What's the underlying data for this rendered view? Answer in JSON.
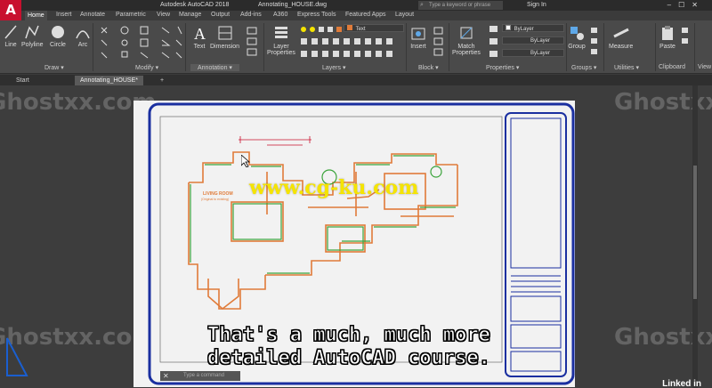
{
  "titlebar": {
    "app_title": "Autodesk AutoCAD 2018",
    "file_name": "Annotating_HOUSE.dwg",
    "search_placeholder": "Type a keyword or phrase",
    "signin": "Sign In",
    "window_buttons": "–☐✕"
  },
  "logo": {
    "letter": "A"
  },
  "ribbon_tabs": [
    {
      "label": "Home",
      "active": true
    },
    {
      "label": "Insert"
    },
    {
      "label": "Annotate"
    },
    {
      "label": "Parametric"
    },
    {
      "label": "View"
    },
    {
      "label": "Manage"
    },
    {
      "label": "Output"
    },
    {
      "label": "Add-ins"
    },
    {
      "label": "A360"
    },
    {
      "label": "Express Tools"
    },
    {
      "label": "Featured Apps"
    },
    {
      "label": "Layout"
    }
  ],
  "ribbon": {
    "draw": {
      "line": "Line",
      "polyline": "Polyline",
      "circle": "Circle",
      "arc": "Arc",
      "panel": "Draw"
    },
    "modify": {
      "panel": "Modify"
    },
    "annotation": {
      "text": "Text",
      "dimension": "Dimension",
      "panel": "Annotation"
    },
    "layers": {
      "layer_properties_l1": "Layer",
      "layer_properties_l2": "Properties",
      "layer_name": "Text",
      "panel": "Layers"
    },
    "block": {
      "insert": "Insert",
      "panel": "Block"
    },
    "properties": {
      "match_l1": "Match",
      "match_l2": "Properties",
      "bylayer_color": "ByLayer",
      "bylayer_lineweight": "ByLayer",
      "bylayer_linetype": "ByLayer",
      "panel": "Properties"
    },
    "groups": {
      "group": "Group",
      "panel": "Groups"
    },
    "utilities": {
      "measure": "Measure",
      "panel": "Utilities"
    },
    "clipboard": {
      "paste": "Paste",
      "panel": "Clipboard"
    },
    "view": {
      "panel": "View"
    }
  },
  "doc_tabs": [
    {
      "label": "Start"
    },
    {
      "label": "Annotating_HOUSE*",
      "active": true
    },
    {
      "label": "+"
    }
  ],
  "drawing": {
    "living_room_label": "LIVING ROOM",
    "living_room_sub": "(Original to existing)"
  },
  "overlay": {
    "watermark": "Ghostxx.com",
    "center_watermark": "www.cg-ku.com",
    "subtitle_line1": "That's a much, much more",
    "subtitle_line2": "detailed AutoCAD course.",
    "linkedin": "Linked in"
  },
  "command_line": {
    "placeholder": "Type a command"
  },
  "colors": {
    "accent_red": "#c8102e",
    "wall_orange": "#e07b39",
    "wall_green": "#3aa33a",
    "border_blue": "#1a2fa0",
    "ribbon_bg": "#4a4a4a"
  }
}
